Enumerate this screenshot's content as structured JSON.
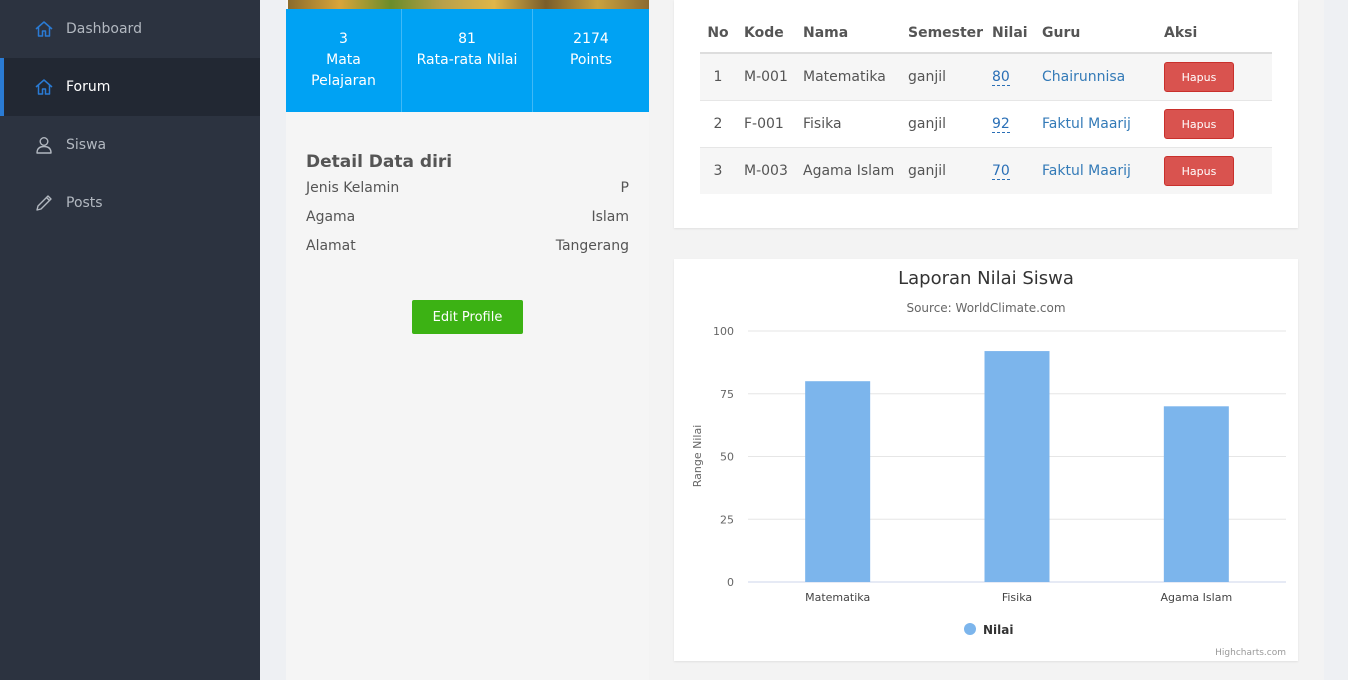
{
  "sidebar": {
    "items": [
      {
        "label": "Dashboard",
        "icon": "home-icon",
        "active": false
      },
      {
        "label": "Forum",
        "icon": "home-icon",
        "active": true
      },
      {
        "label": "Siswa",
        "icon": "user-icon",
        "active": false
      },
      {
        "label": "Posts",
        "icon": "pencil-icon",
        "active": false
      }
    ]
  },
  "profile": {
    "stats": [
      {
        "value": "3",
        "label": "Mata Pelajaran"
      },
      {
        "value": "81",
        "label": "Rata-rata Nilai"
      },
      {
        "value": "2174",
        "label": "Points"
      }
    ],
    "detail_title": "Detail Data diri",
    "details": [
      {
        "key": "Jenis Kelamin",
        "value": "P"
      },
      {
        "key": "Agama",
        "value": "Islam"
      },
      {
        "key": "Alamat",
        "value": "Tangerang"
      }
    ],
    "edit_button": "Edit Profile"
  },
  "table": {
    "headers": [
      "No",
      "Kode",
      "Nama",
      "Semester",
      "Nilai",
      "Guru",
      "Aksi"
    ],
    "rows": [
      {
        "no": "1",
        "kode": "M-001",
        "nama": "Matematika",
        "semester": "ganjil",
        "nilai": "80",
        "guru": "Chairunnisa",
        "aksi": "Hapus"
      },
      {
        "no": "2",
        "kode": "F-001",
        "nama": "Fisika",
        "semester": "ganjil",
        "nilai": "92",
        "guru": "Faktul Maarij",
        "aksi": "Hapus"
      },
      {
        "no": "3",
        "kode": "M-003",
        "nama": "Agama Islam",
        "semester": "ganjil",
        "nilai": "70",
        "guru": "Faktul Maarij",
        "aksi": "Hapus"
      }
    ]
  },
  "chart_data": {
    "type": "bar",
    "title": "Laporan Nilai Siswa",
    "subtitle": "Source: WorldClimate.com",
    "categories": [
      "Matematika",
      "Fisika",
      "Agama Islam"
    ],
    "series": [
      {
        "name": "Nilai",
        "values": [
          80,
          92,
          70
        ]
      }
    ],
    "ylabel": "Range Nilai",
    "xlabel": "",
    "ylim": [
      0,
      100
    ],
    "yticks": [
      0,
      25,
      50,
      75,
      100
    ],
    "grid": true,
    "legend": "bottom-center",
    "credit": "Highcharts.com",
    "bar_color": "#7cb5ec"
  },
  "colors": {
    "sidebar_bg": "#2c3340",
    "accent": "#2a7bd4",
    "stats_bg": "#00a2f3",
    "edit_button": "#3cb214",
    "delete_button": "#d9534f"
  }
}
